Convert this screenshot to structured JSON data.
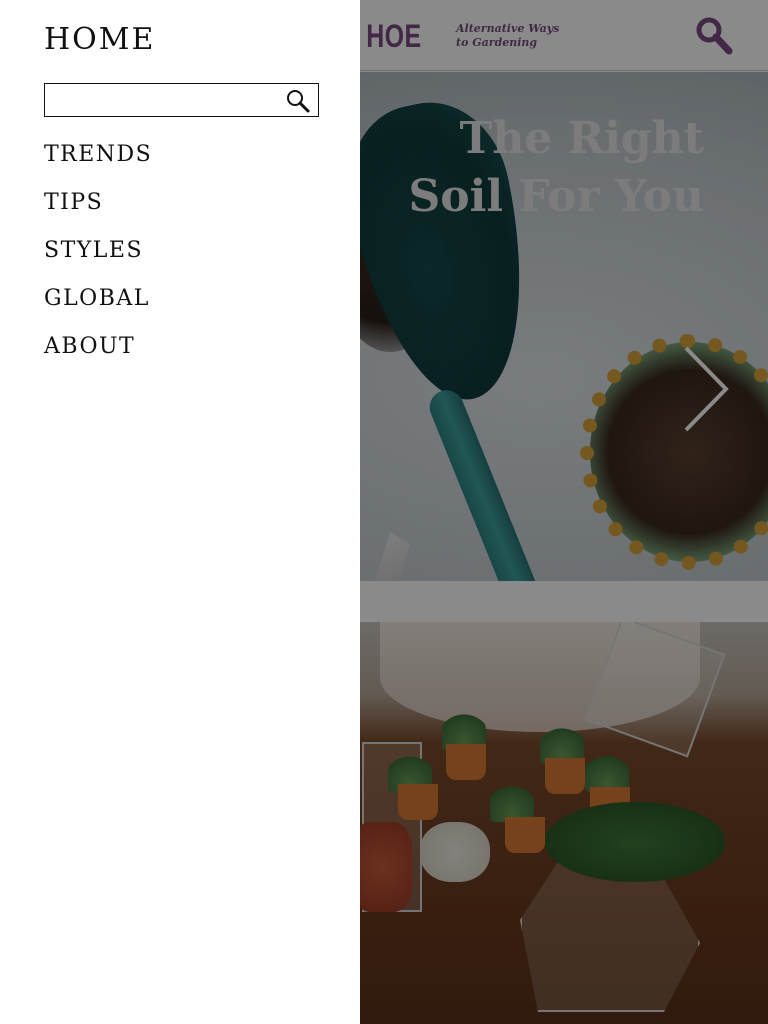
{
  "header": {
    "logo_text": "E A HOE",
    "tagline_line1": "Alternative Ways",
    "tagline_line2": "to Gardening"
  },
  "hero": {
    "title_line1": "The Right",
    "title_line2": "Soil For You"
  },
  "drawer": {
    "home_label": "HOME",
    "search": {
      "value": "",
      "placeholder": ""
    },
    "items": [
      {
        "label": "TRENDS"
      },
      {
        "label": "TIPS"
      },
      {
        "label": "STYLES"
      },
      {
        "label": "GLOBAL"
      },
      {
        "label": "ABOUT"
      }
    ]
  },
  "icons": {
    "drawer_search": "search-icon",
    "header_search": "search-icon",
    "hero_next": "chevron-right-icon"
  },
  "colors": {
    "brand": "#7a4a82",
    "overlay": "#000000",
    "drawer_background": "#ffffff",
    "text": "#111111"
  }
}
